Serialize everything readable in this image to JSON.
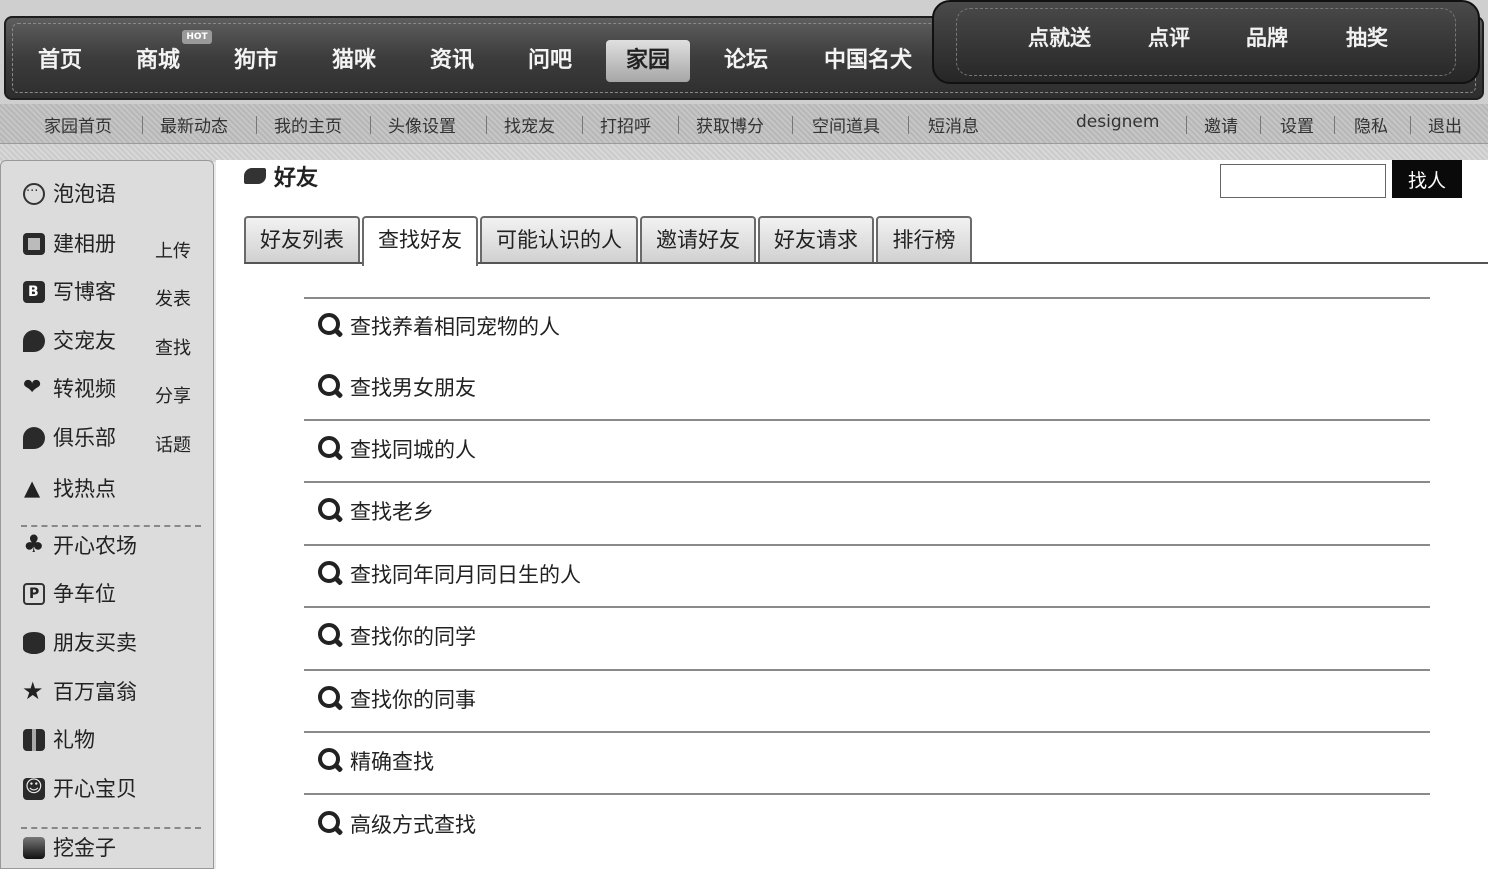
{
  "nav": {
    "items": [
      {
        "label": "首页"
      },
      {
        "label": "商城",
        "badge": "HOT"
      },
      {
        "label": "狗市"
      },
      {
        "label": "猫咪"
      },
      {
        "label": "资讯"
      },
      {
        "label": "问吧"
      },
      {
        "label": "家园",
        "active": true
      },
      {
        "label": "论坛"
      },
      {
        "label": "中国名犬"
      }
    ],
    "promo": [
      "点就送",
      "点评",
      "品牌",
      "抽奖"
    ]
  },
  "subnav": {
    "links": [
      "家园首页",
      "最新动态",
      "我的主页",
      "头像设置",
      "找宠友",
      "打招呼",
      "获取博分",
      "空间道具",
      "短消息"
    ],
    "username": "designem",
    "right_links": [
      "邀请",
      "设置",
      "隐私",
      "退出"
    ]
  },
  "sidebar": {
    "items": [
      {
        "label": "泡泡语",
        "icon": "speech-bubble-icon"
      },
      {
        "label": "建相册",
        "icon": "photo-album-icon",
        "action": "上传"
      },
      {
        "label": "写博客",
        "icon": "blog-icon",
        "action": "发表"
      },
      {
        "label": "交宠友",
        "icon": "pin-icon",
        "action": "查找"
      },
      {
        "label": "转视频",
        "icon": "heart-icon",
        "action": "分享"
      },
      {
        "label": "俱乐部",
        "icon": "pin-icon",
        "action": "话题"
      },
      {
        "label": "找热点",
        "icon": "fire-icon"
      }
    ],
    "apps": [
      {
        "label": "开心农场",
        "icon": "plant-icon"
      },
      {
        "label": "争车位",
        "icon": "parking-icon"
      },
      {
        "label": "朋友买卖",
        "icon": "coins-icon"
      },
      {
        "label": "百万富翁",
        "icon": "star-icon"
      },
      {
        "label": "礼物",
        "icon": "gift-icon"
      },
      {
        "label": "开心宝贝",
        "icon": "baby-icon"
      }
    ],
    "extra": [
      {
        "label": "挖金子",
        "icon": "gold-icon"
      }
    ]
  },
  "main": {
    "title": "好友",
    "search_button": "找人",
    "search_value": "",
    "tabs": [
      {
        "label": "好友列表"
      },
      {
        "label": "查找好友",
        "active": true
      },
      {
        "label": "可能认识的人"
      },
      {
        "label": "邀请好友"
      },
      {
        "label": "好友请求"
      },
      {
        "label": "排行榜"
      }
    ],
    "find_options": [
      "查找养着相同宠物的人",
      "查找男女朋友",
      "查找同城的人",
      "查找老乡",
      "查找同年同月同日生的人",
      "查找你的同学",
      "查找你的同事",
      "精确查找",
      "高级方式查找"
    ]
  }
}
